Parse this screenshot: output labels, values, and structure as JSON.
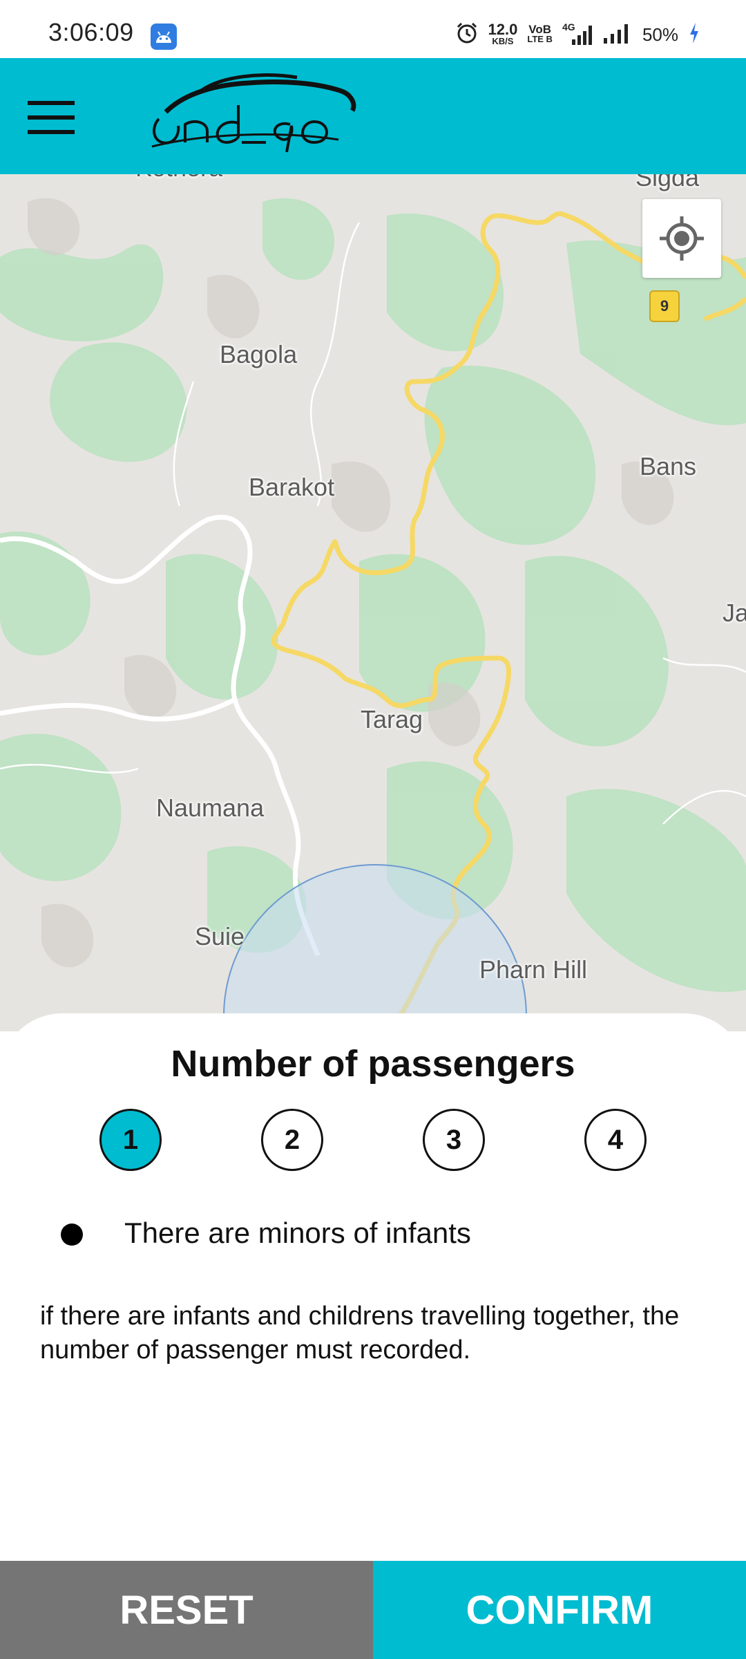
{
  "status_bar": {
    "time": "3:06:09",
    "speed_value": "12.0",
    "speed_unit": "KB/S",
    "volte_top": "VoB",
    "volte_bottom": "LTE B",
    "network": "4G",
    "battery": "50%"
  },
  "app_bar": {
    "logo_text": "andgo",
    "menu_icon": "hamburger-menu-icon"
  },
  "map": {
    "labels": [
      "Kothera",
      "Sigda",
      "Bagola",
      "Bans",
      "Barakot",
      "Ja",
      "Tarag",
      "Naumana",
      "Suie",
      "Pharn Hill"
    ],
    "route_badge": "9",
    "locate_icon": "my-location-icon"
  },
  "sheet": {
    "title": "Number of passengers",
    "options": [
      "1",
      "2",
      "3",
      "4"
    ],
    "selected_option": "1",
    "minors_label": "There are minors of infants",
    "note": "if there are infants and childrens travelling together, the number of passenger must recorded."
  },
  "footer": {
    "reset": "RESET",
    "confirm": "CONFIRM"
  },
  "colors": {
    "accent": "#00bcd0",
    "reset_bg": "#757575",
    "map_bg": "#e7e5e1",
    "road": "#f6d865"
  }
}
